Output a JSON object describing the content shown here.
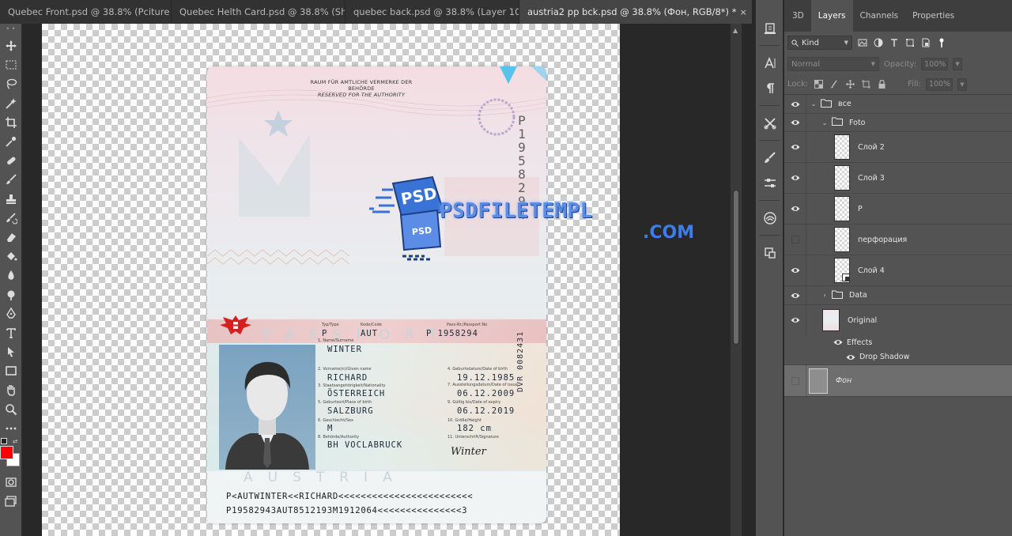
{
  "tabs": [
    {
      "label": "Quebec Front.psd @ 38.8% (Pciture ..."
    },
    {
      "label": "Quebec Helth Card.psd @ 38.8% (Sh..."
    },
    {
      "label": "quebec back.psd @ 38.8% (Layer 10,..."
    },
    {
      "label": "austria2 pp bck.psd @ 38.8% (Фон, RGB/8*) *"
    }
  ],
  "tab_close_glyph": "×",
  "colors": {
    "foreground": "#ff0000",
    "background": "#ffffff",
    "watermark": "#5b8de6"
  },
  "toolbar": {
    "tools": [
      "move-tool-icon",
      "marquee-tool-icon",
      "lasso-tool-icon",
      "magic-wand-icon",
      "crop-tool-icon",
      "eyedropper-icon",
      "healing-brush-icon",
      "brush-tool-icon",
      "clone-stamp-icon",
      "history-brush-icon",
      "eraser-icon",
      "paint-bucket-icon",
      "blur-tool-icon",
      "dodge-tool-icon",
      "pen-tool-icon",
      "type-tool-icon",
      "path-selection-icon",
      "rectangle-tool-icon",
      "hand-tool-icon",
      "zoom-tool-icon",
      "more-tools-icon"
    ]
  },
  "passport": {
    "authority_de": "RAUM FÜR AMTLICHE VERMERKE DER BEHÖRDE",
    "authority_en": "RESERVED FOR THE AUTHORITY",
    "word_passport": "PASSPORT",
    "word_austria": "AUSTRIA",
    "labels": {
      "type": "Typ/Type",
      "code": "Kode/Code",
      "passport_no": "Pass-Nr./Passport No",
      "surname": "1. Name/Surname",
      "given_names": "2. Vorname(n)/Given name",
      "nationality": "3. Staatsangehörigkeit/Nationality",
      "place_of_birth": "5. Geburtsort/Place of birth",
      "sex": "6. Geschlecht/Sex",
      "authority": "8. Behörde/Authority",
      "date_of_birth": "4. Geburtsdatum/Date of birth",
      "date_of_issue": "7. Ausstellungsdatum/Date of issue",
      "date_of_expiry": "9. Gültig bis/Date of expiry",
      "height": "10. Größe/Height",
      "signature": "11. Unterschrift/Signature"
    },
    "type": "P",
    "code": "AUT",
    "passport_number": "P 1958294",
    "surname": "WINTER",
    "given_names": "RICHARD",
    "nationality": "ÖSTERREICH",
    "place_of_birth": "SALZBURG",
    "sex": "M",
    "authority": "BH VOCLABRUCK",
    "date_of_birth": "19.12.1985",
    "date_of_issue": "06.12.2009",
    "date_of_expiry": "06.12.2019",
    "height": "182 cm",
    "signature": "Winter",
    "doc_vertical": "DVR 0082431",
    "perforation": "P1958294",
    "mrz_line1": "P<AUTWINTER<<RICHARD<<<<<<<<<<<<<<<<<<<<<<<<",
    "mrz_line2": "P19582943AUT8512193M1912064<<<<<<<<<<<<<<<3"
  },
  "watermark": {
    "badge": "PSD",
    "badge_small": "PSD",
    "text": "PSDFILETEMPL",
    "domain": ".COM"
  },
  "side_icons": [
    "learn-panel-icon",
    "character-panel-icon",
    "paragraph-panel-icon",
    "tools-panel-icon",
    "brush-settings-icon",
    "adjustments-icon",
    "libraries-icon",
    "plugins-icon"
  ],
  "panel": {
    "tabs": [
      "3D",
      "Layers",
      "Channels",
      "Properties"
    ],
    "active_tab": "Layers",
    "kind": "Kind",
    "blend_mode": "Normal",
    "opacity_label": "Opacity:",
    "opacity": "100%",
    "lock_label": "Lock:",
    "fill_label": "Fill:",
    "fill": "100%"
  },
  "layers": [
    {
      "name": "все",
      "type": "group",
      "visible": true,
      "indent": 0,
      "expanded": true
    },
    {
      "name": "Foto",
      "type": "group",
      "visible": true,
      "indent": 1,
      "expanded": true
    },
    {
      "name": "Слой 2",
      "type": "layer",
      "visible": true,
      "indent": 2
    },
    {
      "name": "Слой 3",
      "type": "layer",
      "visible": true,
      "indent": 2
    },
    {
      "name": "P",
      "type": "layer",
      "visible": true,
      "indent": 2
    },
    {
      "name": "перфорация",
      "type": "layer",
      "visible": false,
      "indent": 2
    },
    {
      "name": "Слой 4",
      "type": "smart",
      "visible": true,
      "indent": 2
    },
    {
      "name": "Data",
      "type": "group",
      "visible": true,
      "indent": 1,
      "expanded": false
    },
    {
      "name": "Original",
      "type": "layer",
      "visible": true,
      "indent": 1
    },
    {
      "name": "Effects",
      "type": "effects",
      "visible": true
    },
    {
      "name": "Drop Shadow",
      "type": "effect",
      "visible": true
    },
    {
      "name": "Фон",
      "type": "background",
      "visible": false,
      "selected": true
    }
  ]
}
